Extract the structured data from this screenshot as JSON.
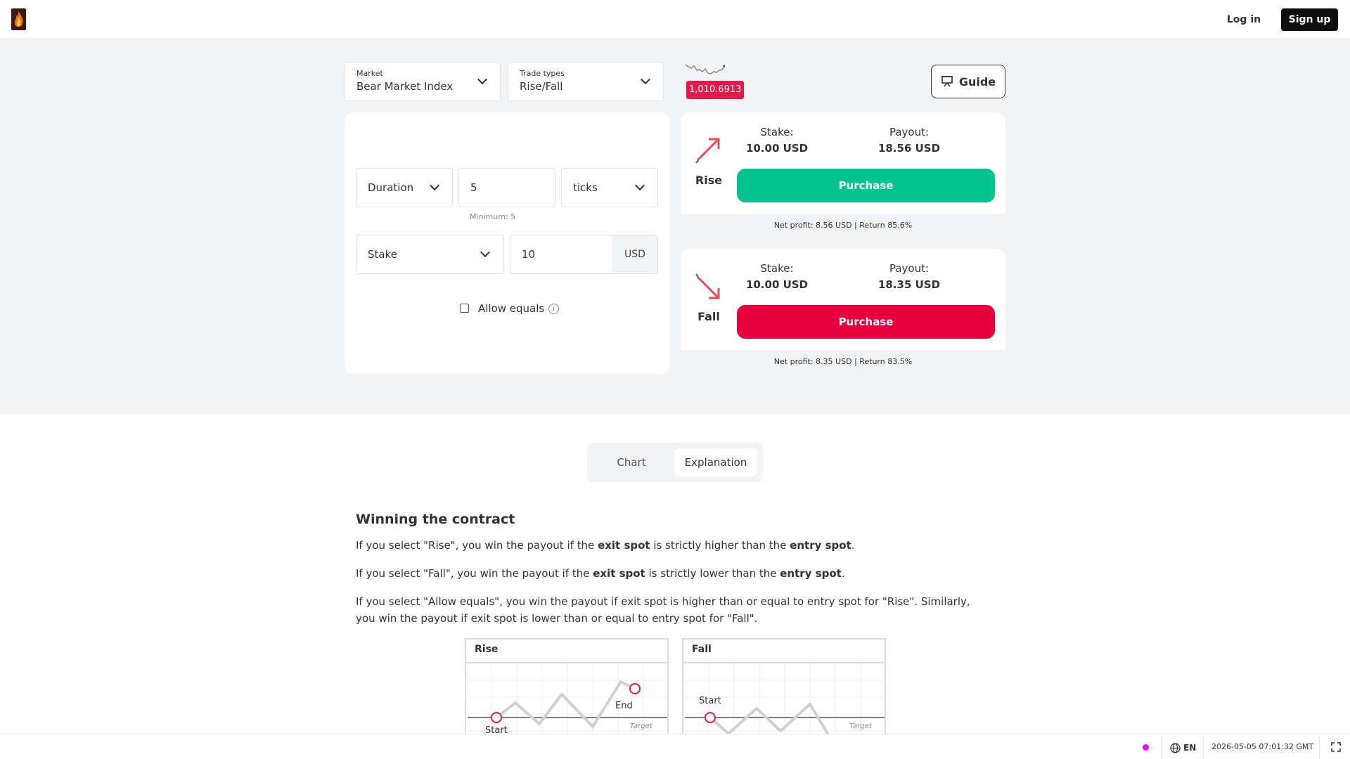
{
  "header": {
    "login": "Log in",
    "signup": "Sign up"
  },
  "market": {
    "label": "Market",
    "value": "Bear Market Index"
  },
  "trade_type": {
    "label": "Trade types",
    "value": "Rise/Fall"
  },
  "spot_price": "1,010.6913",
  "guide_label": "Guide",
  "duration": {
    "type": "Duration",
    "value": "5",
    "unit": "ticks",
    "minimum": "Minimum: 5"
  },
  "stake": {
    "type": "Stake",
    "value": "10",
    "currency": "USD"
  },
  "allow_equals": {
    "label": "Allow equals",
    "checked": false
  },
  "rise": {
    "name": "Rise",
    "stake_label": "Stake:",
    "stake_value": "10.00 USD",
    "payout_label": "Payout:",
    "payout_value": "18.56 USD",
    "button": "Purchase",
    "footer": "Net profit: 8.56 USD | Return 85.6%",
    "color": "#00c390"
  },
  "fall": {
    "name": "Fall",
    "stake_label": "Stake:",
    "stake_value": "10.00 USD",
    "payout_label": "Payout:",
    "payout_value": "18.35 USD",
    "button": "Purchase",
    "footer": "Net profit: 8.35 USD | Return 83.5%",
    "color": "#e6003e"
  },
  "tabs": {
    "chart": "Chart",
    "explanation": "Explanation",
    "active": "Explanation"
  },
  "explanation": {
    "title": "Winning the contract",
    "p1": [
      "If you select \"Rise\", you win the payout if the ",
      "exit spot",
      " is strictly higher than the ",
      "entry spot",
      "."
    ],
    "p2": [
      "If you select \"Fall\", you win the payout if the ",
      "exit spot",
      " is strictly lower than the ",
      "entry spot",
      "."
    ],
    "p3": "If you select \"Allow equals\", you win the payout if exit spot is higher than or equal to entry spot for \"Rise\". Similarly, you win the payout if exit spot is lower than or equal to entry spot for \"Fall\".",
    "fig_rise": {
      "title": "Rise",
      "start": "Start",
      "end": "End",
      "target": "Target"
    },
    "fig_fall": {
      "title": "Fall",
      "start": "Start",
      "target": "Target"
    }
  },
  "status_bar": {
    "language": "EN",
    "datetime": "2026-05-05 07:01:32 GMT",
    "connection_color": "#ea0ce0"
  }
}
